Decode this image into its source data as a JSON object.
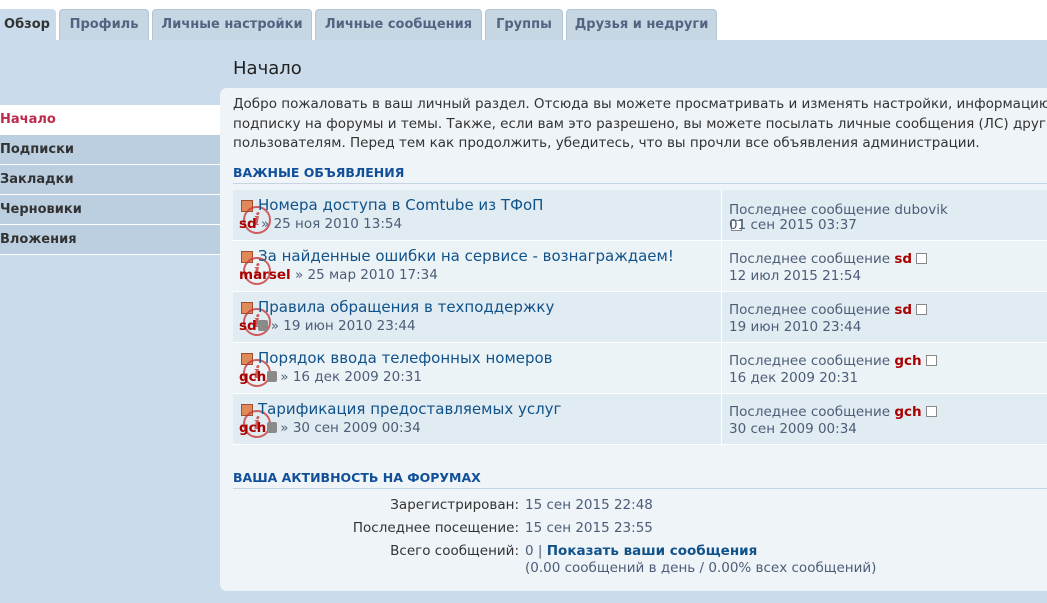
{
  "tabs": [
    {
      "label": "Обзор",
      "active": true
    },
    {
      "label": "Профиль"
    },
    {
      "label": "Личные настройки"
    },
    {
      "label": "Личные сообщения"
    },
    {
      "label": "Группы"
    },
    {
      "label": "Друзья и недруги"
    }
  ],
  "sidebar": {
    "items": [
      {
        "label": "Начало",
        "active": true
      },
      {
        "label": "Подписки"
      },
      {
        "label": "Закладки"
      },
      {
        "label": "Черновики"
      },
      {
        "label": "Вложения"
      }
    ]
  },
  "page": {
    "title": "Начало",
    "intro": [
      "Добро пожаловать в ваш личный раздел. Отсюда вы можете просматривать и изменять настройки, информацию",
      "подписку на форумы и темы. Также, если вам это разрешено, вы можете посылать личные сообщения (ЛС) друг",
      "пользователям. Перед тем как продолжить, убедитесь, что вы прочли все объявления администрации."
    ]
  },
  "announcements": {
    "heading": "Важные объявления",
    "topics": [
      {
        "title": "Номера доступа в Comtube из ТФоП",
        "author": "sd",
        "sep": "»",
        "date": "25 ноя 2010 13:54",
        "last_label": "Последнее сообщение",
        "last_author": "dubovik",
        "last_time": "01 сен 2015 03:37",
        "locked": false
      },
      {
        "title": "За найденные ошибки на сервисе - вознаграждаем!",
        "author": "marsel",
        "sep": "»",
        "date": "25 мар 2010 17:34",
        "last_label": "Последнее сообщение",
        "last_author": "sd",
        "last_time": "12 июл 2015 21:54",
        "locked": false
      },
      {
        "title": "Правила обращения в техподдержку",
        "author": "sd",
        "sep": "»",
        "date": "19 июн 2010 23:44",
        "last_label": "Последнее сообщение",
        "last_author": "sd",
        "last_time": "19 июн 2010 23:44",
        "locked": true
      },
      {
        "title": "Порядок ввода телефонных номеров",
        "author": "gch",
        "sep": "»",
        "date": "16 дек 2009 20:31",
        "last_label": "Последнее сообщение",
        "last_author": "gch",
        "last_time": "16 дек 2009 20:31",
        "locked": true
      },
      {
        "title": "Тарификация предоставляемых услуг",
        "author": "gch",
        "sep": "»",
        "date": "30 сен 2009 00:34",
        "last_label": "Последнее сообщение",
        "last_author": "gch",
        "last_time": "30 сен 2009 00:34",
        "locked": true
      }
    ]
  },
  "activity": {
    "heading": "Ваша активность на форумах",
    "registered_label": "Зарегистрирован:",
    "registered_value": "15 сен 2015 22:48",
    "last_visit_label": "Последнее посещение:",
    "last_visit_value": "15 сен 2015 23:55",
    "posts_label": "Всего сообщений:",
    "posts_count": "0",
    "posts_sep": "|",
    "posts_link": "Показать ваши сообщения",
    "posts_stats": "(0.00 сообщений в день / 0.00% всех сообщений)"
  },
  "colors": {
    "background": "#cadceb",
    "link": "#105289",
    "author": "#aa0000",
    "active_sidebar": "#bc2a4d"
  }
}
